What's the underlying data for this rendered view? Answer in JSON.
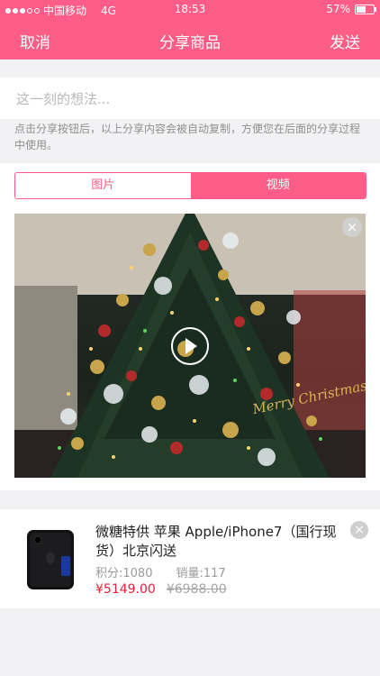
{
  "status_bar": {
    "carrier": "中国移动",
    "network": "4G",
    "time": "18:53",
    "battery": "57%",
    "battery_level": 0.57
  },
  "nav": {
    "cancel": "取消",
    "title": "分享商品",
    "send": "发送"
  },
  "input": {
    "placeholder": "这一刻的想法...",
    "value": ""
  },
  "hint": "点击分享按钮后，以上分享内容会被自动复制，方便您在后面的分享过程中使用。",
  "media_tabs": {
    "image": "图片",
    "video": "视频",
    "selected": "video"
  },
  "video_overlay_text": "Merry Christmas",
  "product": {
    "name": "微糖特供 苹果 Apple/iPhone7（国行现货）北京闪送",
    "points": "积分:1080",
    "sales": "销量:117",
    "price": "¥5149.00",
    "original_price": "¥6988.00"
  },
  "colors": {
    "brand": "#fd5d86",
    "price": "#e0223a"
  },
  "icons": {
    "play": "play-icon",
    "close": "close-icon"
  }
}
